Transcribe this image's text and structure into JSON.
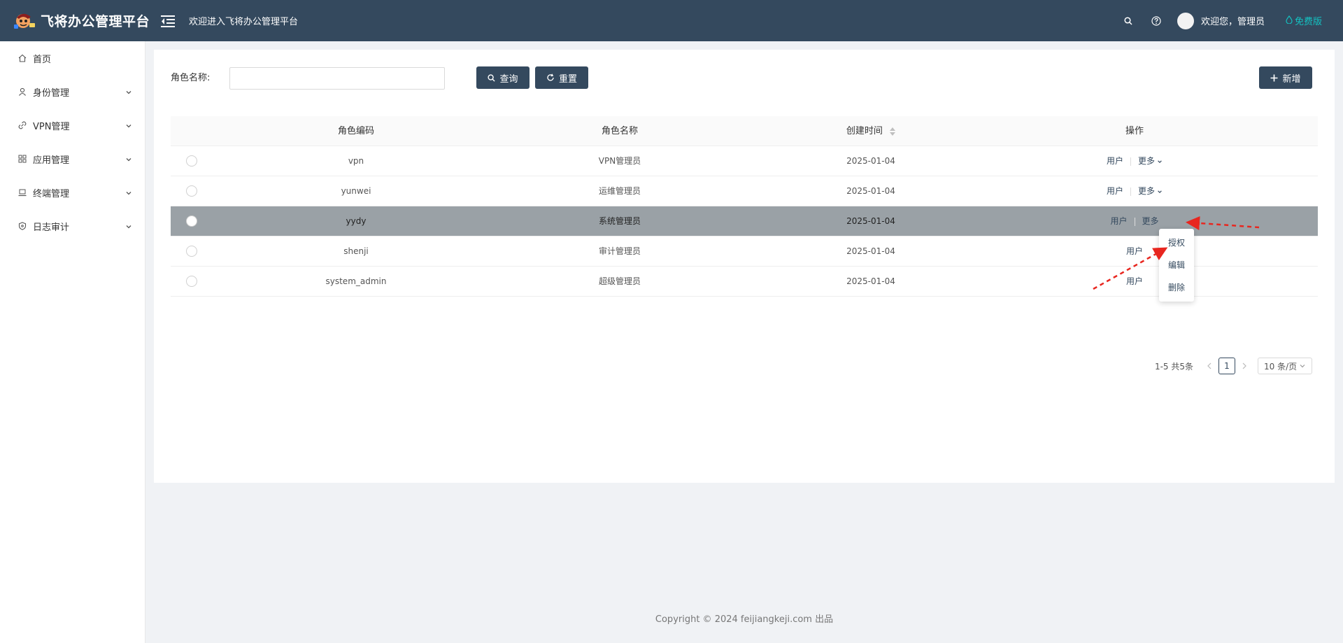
{
  "header": {
    "logo_text": "飞将办公管理平台",
    "welcome": "欢迎进入飞将办公管理平台",
    "user_greeting": "欢迎您，管理员",
    "edition": "免费版",
    "icons": [
      "menu-fold-icon",
      "search-icon",
      "question-icon",
      "droplet-icon"
    ]
  },
  "sidebar": {
    "items": [
      {
        "label": "首页",
        "icon": "home-icon",
        "has_children": false
      },
      {
        "label": "身份管理",
        "icon": "user-icon",
        "has_children": true
      },
      {
        "label": "VPN管理",
        "icon": "link-icon",
        "has_children": true
      },
      {
        "label": "应用管理",
        "icon": "apps-icon",
        "has_children": true
      },
      {
        "label": "终端管理",
        "icon": "laptop-icon",
        "has_children": true
      },
      {
        "label": "日志审计",
        "icon": "shield-icon",
        "has_children": true
      }
    ]
  },
  "search": {
    "label": "角色名称:",
    "value": "",
    "placeholder": "",
    "query_label": "查询",
    "reset_label": "重置",
    "add_label": "新增"
  },
  "table": {
    "columns": [
      "角色编码",
      "角色名称",
      "创建时间",
      "操作"
    ],
    "rows": [
      {
        "code": "vpn",
        "name": "VPN管理员",
        "created": "2025-01-04",
        "selected": false
      },
      {
        "code": "yunwei",
        "name": "运维管理员",
        "created": "2025-01-04",
        "selected": false
      },
      {
        "code": "yydy",
        "name": "系统管理员",
        "created": "2025-01-04",
        "selected": true
      },
      {
        "code": "shenji",
        "name": "审计管理员",
        "created": "2025-01-04",
        "selected": false
      },
      {
        "code": "system_admin",
        "name": "超级管理员",
        "created": "2025-01-04",
        "selected": false
      }
    ],
    "op_user": "用户",
    "op_more": "更多"
  },
  "dropdown": {
    "items": [
      "授权",
      "编辑",
      "删除"
    ]
  },
  "pagination": {
    "total_text": "1-5 共5条",
    "current_page": "1",
    "page_size": "10 条/页"
  },
  "footer": {
    "copyright": "Copyright © 2024 feijiangkeji.com 出品"
  },
  "colors": {
    "header_bg": "#34495e",
    "primary": "#34495e",
    "selected_row": "#9aa1a6",
    "edition": "#13c2c2",
    "annotation": "#e8261f"
  }
}
